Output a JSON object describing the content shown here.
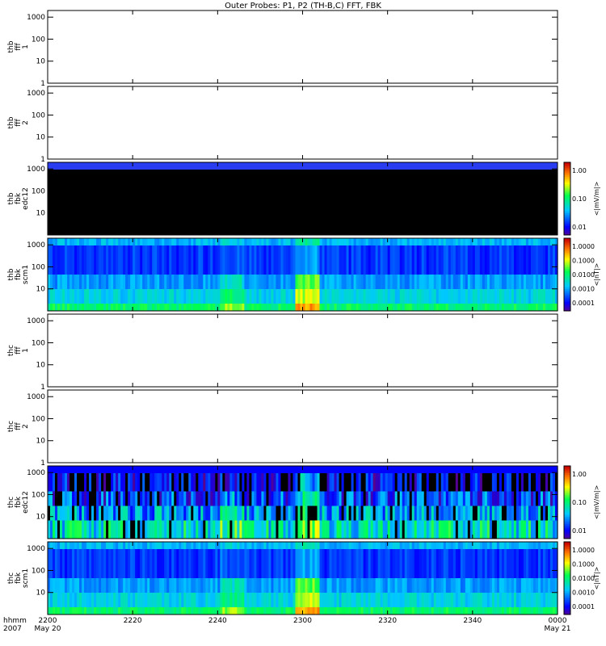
{
  "title": "Outer Probes: P1, P2 (TH-B,C) FFT, FBK",
  "time_axis": {
    "corner_labels": [
      "hhmm",
      "2007"
    ],
    "ticks": [
      {
        "label": "2200",
        "date": "May 20",
        "minutes": 0
      },
      {
        "label": "2220",
        "date": "",
        "minutes": 20
      },
      {
        "label": "2240",
        "date": "",
        "minutes": 40
      },
      {
        "label": "2300",
        "date": "",
        "minutes": 60
      },
      {
        "label": "2320",
        "date": "",
        "minutes": 80
      },
      {
        "label": "2340",
        "date": "",
        "minutes": 100
      },
      {
        "label": "0000",
        "date": "May 21",
        "minutes": 120
      }
    ]
  },
  "chart_data": [
    {
      "type": "heatmap",
      "ylabel": [
        "thb",
        "fff",
        "1"
      ],
      "y_scale": "log",
      "yticks": [
        "1",
        "10",
        "100",
        "1000"
      ],
      "colorbar": null,
      "content": "empty"
    },
    {
      "type": "heatmap",
      "ylabel": [
        "thb",
        "fff",
        "2"
      ],
      "y_scale": "log",
      "yticks": [
        "1",
        "10",
        "100",
        "1000"
      ],
      "colorbar": null,
      "content": "empty"
    },
    {
      "type": "heatmap",
      "ylabel": [
        "thb",
        "fbk",
        "edc12"
      ],
      "y_scale": "log",
      "yticks": [
        "10",
        "100",
        "1000"
      ],
      "colorbar": {
        "label": "<|mV/m|>",
        "ticks": [
          "1.00",
          "0.10",
          "0.01"
        ]
      },
      "content": "black-with-blue-top"
    },
    {
      "type": "heatmap",
      "ylabel": [
        "thb",
        "fbk",
        "scm1"
      ],
      "y_scale": "log",
      "yticks": [
        "10",
        "100",
        "1000"
      ],
      "colorbar": {
        "label": "<|nT|>",
        "ticks": [
          "1.0000",
          "0.1000",
          "0.0100",
          "0.0010",
          "0.0001"
        ]
      },
      "content": "scm-b"
    },
    {
      "type": "heatmap",
      "ylabel": [
        "thc",
        "fff",
        "1"
      ],
      "y_scale": "log",
      "yticks": [
        "1",
        "10",
        "100",
        "1000"
      ],
      "colorbar": null,
      "content": "empty"
    },
    {
      "type": "heatmap",
      "ylabel": [
        "thc",
        "fff",
        "2"
      ],
      "y_scale": "log",
      "yticks": [
        "1",
        "10",
        "100",
        "1000"
      ],
      "colorbar": null,
      "content": "empty"
    },
    {
      "type": "heatmap",
      "ylabel": [
        "thc",
        "fbk",
        "edc12"
      ],
      "y_scale": "log",
      "yticks": [
        "10",
        "100",
        "1000"
      ],
      "colorbar": {
        "label": "<|mV/m|>",
        "ticks": [
          "1.00",
          "0.10",
          "0.01"
        ]
      },
      "content": "edc-c"
    },
    {
      "type": "heatmap",
      "ylabel": [
        "thc",
        "fbk",
        "scm1"
      ],
      "y_scale": "log",
      "yticks": [
        "10",
        "100",
        "1000"
      ],
      "colorbar": {
        "label": "<|nT|>",
        "ticks": [
          "1.0000",
          "0.1000",
          "0.0100",
          "0.0010",
          "0.0001"
        ]
      },
      "content": "scm-c"
    }
  ]
}
